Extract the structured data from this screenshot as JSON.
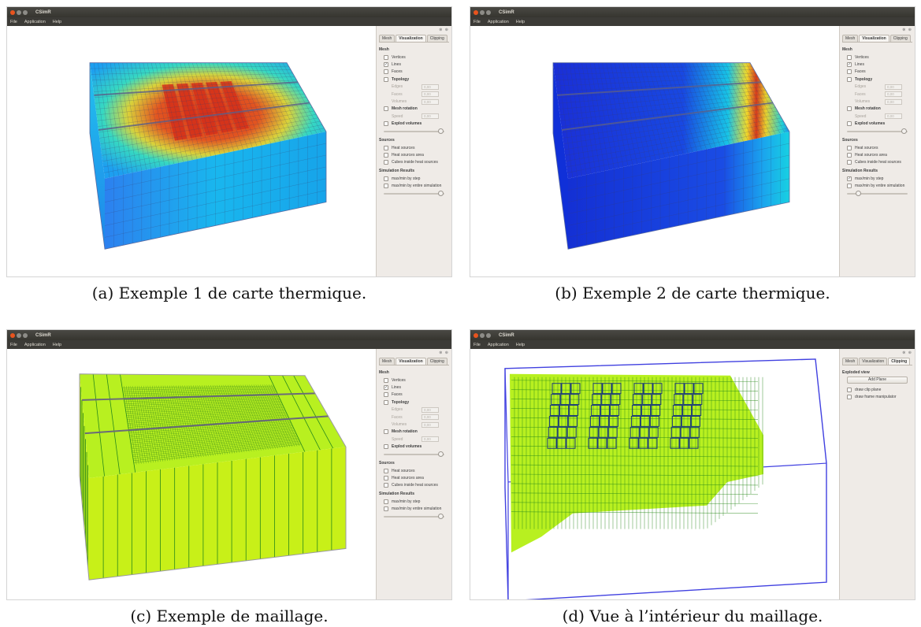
{
  "window": {
    "title": "CSimR",
    "menu": [
      "File",
      "Application",
      "Help"
    ],
    "dock_buttons": "⊗ ⊕"
  },
  "tabs": [
    "Mesh",
    "Visualization",
    "Clipping"
  ],
  "visualization_panel": {
    "mesh_title": "Mesh",
    "vertices": "Vertices",
    "lines": "Lines",
    "faces": "Faces",
    "topology": "Topology",
    "edges": "Edges",
    "faces_param": "Faces",
    "volumes": "Volumes",
    "param_value": "0,00",
    "mesh_rotation": "Mesh rotation",
    "speed": "Speed",
    "explod_volumes": "Explod volumes",
    "sources_title": "Sources",
    "heat_sources": "Heat sources",
    "heat_sources_area": "Heat sources area",
    "cubes_inside": "Cubes inside heat sources",
    "sim_title": "Simulation Results",
    "maxmin_step": "max/min by step",
    "maxmin_entire": "max/min by entire simulation"
  },
  "clipping_panel": {
    "exploded_view": "Exploded view",
    "add_plane": "Add Plane",
    "draw_clip_plane": "draw clip plane",
    "draw_frame": "draw frame manipulator"
  },
  "panels": [
    {
      "caption": "(a) Exemple 1 de carte thermique.",
      "active_tab": "Visualization",
      "vertices_checked": false,
      "lines_checked": true,
      "sim_step_checked": false,
      "explode_level": 0.95,
      "sim_slider_level": 0.95
    },
    {
      "caption": "(b) Exemple 2 de carte thermique.",
      "active_tab": "Visualization",
      "vertices_checked": false,
      "lines_checked": true,
      "sim_step_checked": true,
      "explode_level": 0.95,
      "sim_slider_level": 0.2
    },
    {
      "caption": "(c) Exemple de maillage.",
      "active_tab": "Visualization",
      "vertices_checked": false,
      "lines_checked": true,
      "sim_step_checked": false,
      "explode_level": 0.95,
      "sim_slider_level": 0.95
    },
    {
      "caption": "(d) Vue à l’intérieur du maillage.",
      "active_tab": "Clipping"
    }
  ],
  "colors": {
    "hot": "#d3301a",
    "cold_a": "#1a8bf0",
    "cold_b": "#1030d8",
    "mesh_green": "#b8f020",
    "clip_frame": "#4040e0",
    "grid_dark": "#3a3d6a"
  }
}
